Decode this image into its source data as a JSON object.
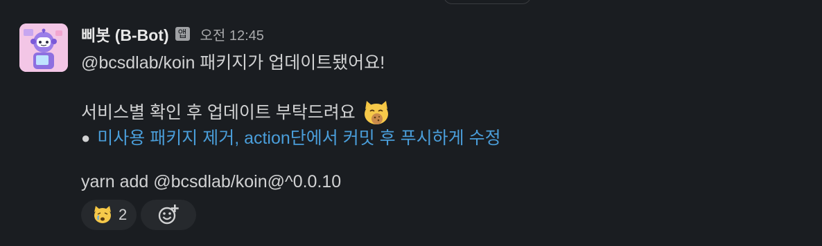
{
  "message": {
    "sender": "삐봇 (B-Bot)",
    "app_badge": "앱",
    "timestamp": "오전 12:45",
    "line1": "@bcsdlab/koin 패키지가 업데이트됐어요!",
    "line2": "서비스별 확인 후 업데이트 부탁드려요",
    "emoji_after_line2": "cat-eating-cookie-emoji",
    "bullet_link": "미사용 패키지 제거, action단에서 커밋 후 푸시하게 수정",
    "command": "yarn add @bcsdlab/koin@^0.0.10"
  },
  "reactions": [
    {
      "emoji": "crying-cat-emoji",
      "count": "2"
    }
  ],
  "add_reaction_icon": "add-emoji-icon",
  "colors": {
    "background": "#1a1d21",
    "text": "#d1d2d3",
    "link": "#4a9eda",
    "reaction_bg": "#26292d"
  }
}
